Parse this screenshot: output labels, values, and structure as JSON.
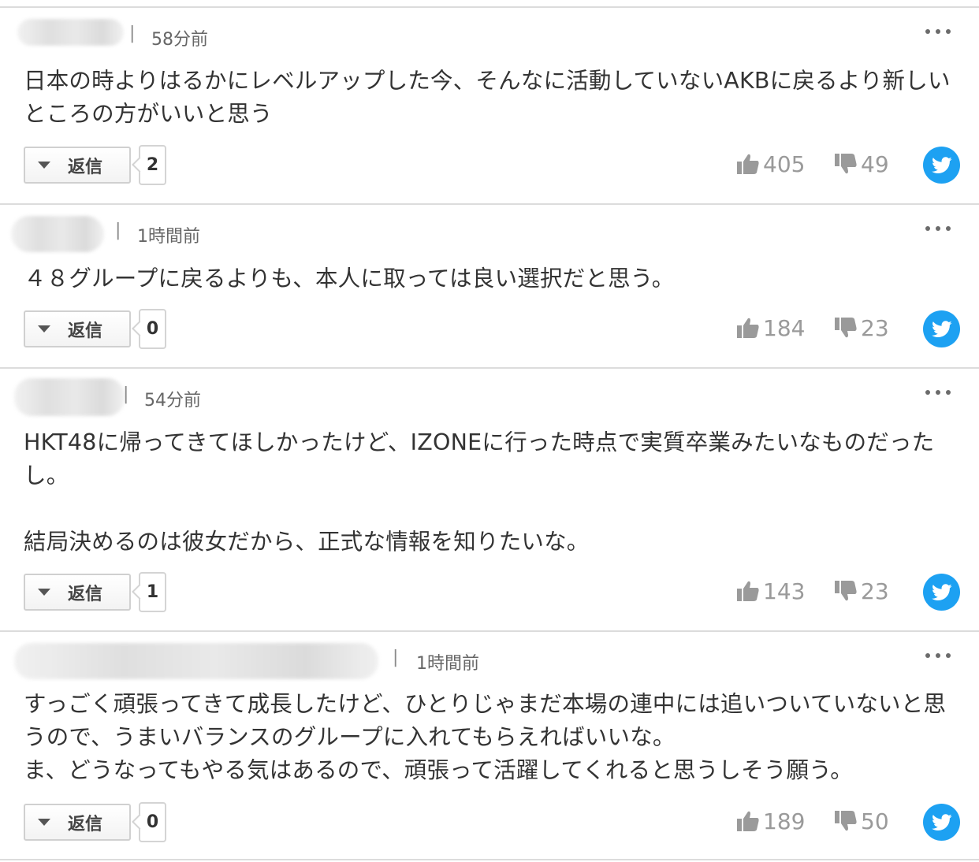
{
  "reply_label": "返信",
  "icons": {
    "like": "thumbs-up-icon",
    "dislike": "thumbs-down-icon",
    "share": "twitter-icon",
    "menu": "more-horizontal-icon"
  },
  "colors": {
    "twitter": "#1da1f2",
    "vote_gray": "#9a9a9a",
    "text": "#333333",
    "separator": "#dcdcdc"
  },
  "comments": [
    {
      "time": "58分前",
      "text": "日本の時よりはるかにレベルアップした今、そんなに活動していないAKBに戻るより新しいところの方がいいと思う",
      "replies": "2",
      "likes": "405",
      "dislikes": "49"
    },
    {
      "time": "1時間前",
      "text": "４８グループに戻るよりも、本人に取っては良い選択だと思う。",
      "replies": "0",
      "likes": "184",
      "dislikes": "23"
    },
    {
      "time": "54分前",
      "text": "HKT48に帰ってきてほしかったけど、IZONEに行った時点で実質卒業みたいなものだったし。\n\n結局決めるのは彼女だから、正式な情報を知りたいな。",
      "replies": "1",
      "likes": "143",
      "dislikes": "23"
    },
    {
      "time": "1時間前",
      "text": "すっごく頑張ってきて成長したけど、ひとりじゃまだ本場の連中には追いついていないと思うので、うまいバランスのグループに入れてもらえればいいな。\nま、どうなってもやる気はあるので、頑張って活躍してくれると思うしそう願う。",
      "replies": "0",
      "likes": "189",
      "dislikes": "50"
    }
  ]
}
